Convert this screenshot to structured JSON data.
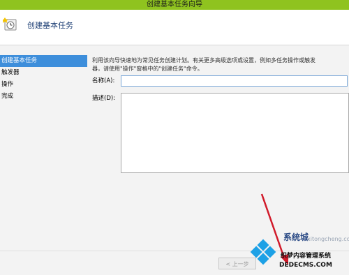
{
  "window": {
    "title": "创建基本任务向导"
  },
  "header": {
    "icon": "task-wizard-icon",
    "heading": "创建基本任务"
  },
  "steps": [
    {
      "label": "创建基本任务",
      "active": true
    },
    {
      "label": "触发器",
      "active": false
    },
    {
      "label": "操作",
      "active": false
    },
    {
      "label": "完成",
      "active": false
    }
  ],
  "content": {
    "intro_line1": "利用该向导快速地为常见任务创建计划。有关更多高级选项或设置，例如多任务操作或触发",
    "intro_line2": "器，请使用\"操作\"窗格中的\"创建任务\"命令。",
    "name_label": "名称(A):",
    "name_value": "",
    "desc_label": "描述(D):",
    "desc_value": ""
  },
  "footer": {
    "prev_button": "< 上一步"
  },
  "watermark": {
    "line1": "系统城",
    "line2": "xitongcheng.com",
    "line3": "织梦内容管理系统",
    "line4": "DEDECMS.COM"
  },
  "colors": {
    "titlebar": "#8fc31f",
    "active_step": "#3d8edb",
    "arrow": "#d11a2a"
  }
}
